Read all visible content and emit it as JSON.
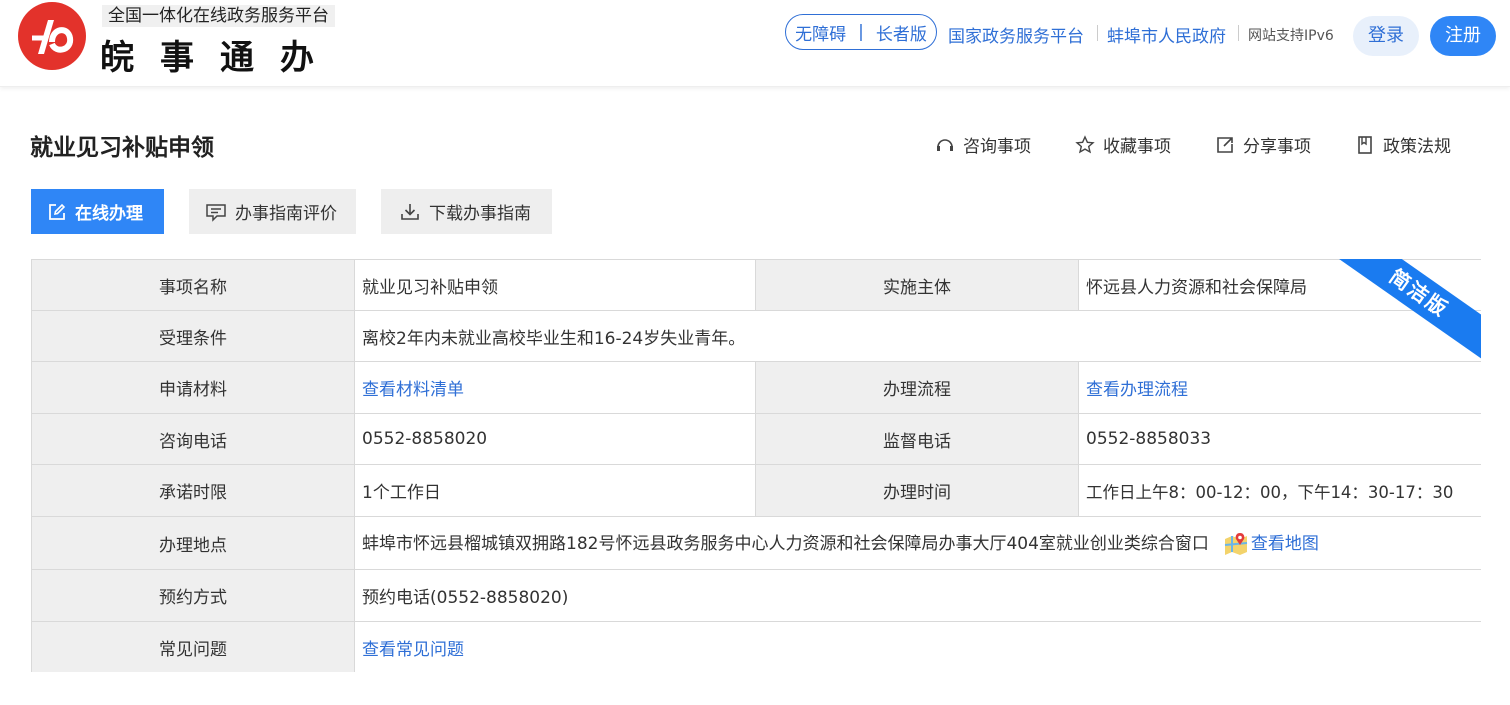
{
  "header": {
    "tagline": "全国一体化在线政务服务平台",
    "brand": "皖事通办",
    "accessibility": "无障碍",
    "elder": "长者版",
    "link_national": "国家政务服务平台",
    "link_city": "蚌埠市人民政府",
    "ipv6": "网站支持IPv6",
    "login": "登录",
    "register": "注册"
  },
  "page": {
    "title": "就业见习补贴申领",
    "actions": [
      "咨询事项",
      "收藏事项",
      "分享事项",
      "政策法规"
    ]
  },
  "buttons": {
    "online": "在线办理",
    "evaluate": "办事指南评价",
    "download": "下载办事指南"
  },
  "ribbon": "简洁版",
  "table": {
    "item_name_label": "事项名称",
    "item_name": "就业见习补贴申领",
    "org_label": "实施主体",
    "org": "怀远县人力资源和社会保障局",
    "condition_label": "受理条件",
    "condition": "离校2年内未就业高校毕业生和16-24岁失业青年。",
    "materials_label": "申请材料",
    "materials_link": "查看材料清单",
    "process_label": "办理流程",
    "process_link": "查看办理流程",
    "consult_label": "咨询电话",
    "consult": "0552-8858020",
    "supervise_label": "监督电话",
    "supervise": "0552-8858033",
    "limit_label": "承诺时限",
    "limit": "1个工作日",
    "hours_label": "办理时间",
    "hours": "工作日上午8：00-12：00，下午14：30-17：30",
    "location_label": "办理地点",
    "location": "蚌埠市怀远县榴城镇双拥路182号怀远县政务服务中心人力资源和社会保障局办事大厅404室就业创业类综合窗口",
    "map_link": "查看地图",
    "appoint_label": "预约方式",
    "appoint": "预约电话(0552-8858020)",
    "faq_label": "常见问题",
    "faq_link": "查看常见问题"
  }
}
